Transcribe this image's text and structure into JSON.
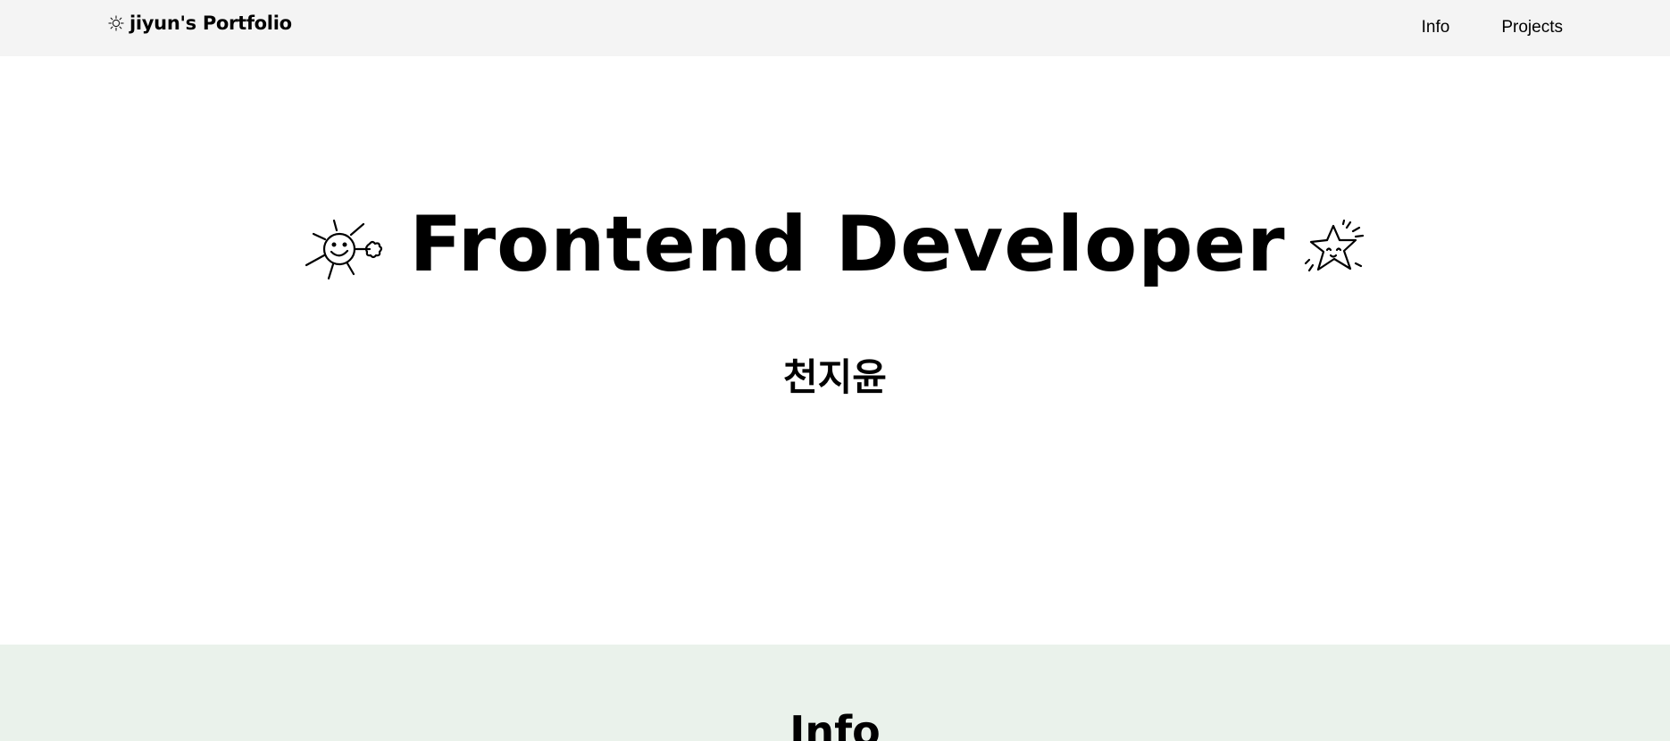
{
  "header": {
    "brand_text": "jiyun's Portfolio",
    "brand_icon": "sparkle-doodle-icon",
    "nav": [
      {
        "label": "Info"
      },
      {
        "label": "Projects"
      }
    ]
  },
  "hero": {
    "title": "Frontend Developer",
    "subtitle": "천지윤",
    "left_icon": "sun-doodle-icon",
    "right_icon": "star-doodle-icon"
  },
  "info": {
    "heading": "Info"
  },
  "colors": {
    "navbar_bg": "#f4f4f4",
    "hero_bg": "#ffffff",
    "info_bg": "#eaf2eb",
    "text": "#000000"
  }
}
